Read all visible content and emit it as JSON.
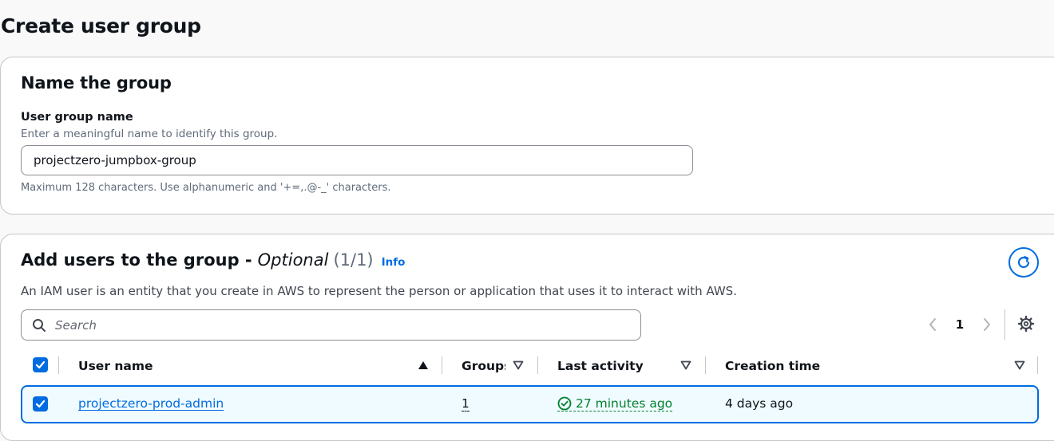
{
  "page": {
    "title": "Create user group"
  },
  "name_section": {
    "title": "Name the group",
    "field_label": "User group name",
    "field_description": "Enter a meaningful name to identify this group.",
    "field_value": "projectzero-jumpbox-group",
    "field_hint": "Maximum 128 characters. Use alphanumeric and '+=,.@-_' characters."
  },
  "users_section": {
    "title": "Add users to the group -",
    "optional": "Optional",
    "count": "(1/1)",
    "info_link": "Info",
    "description": "An IAM user is an entity that you create in AWS to represent the person or application that uses it to interact with AWS.",
    "search_placeholder": "Search",
    "pagination": {
      "current_page": "1"
    },
    "columns": [
      "User name",
      "Groups",
      "Last activity",
      "Creation time"
    ],
    "rows": [
      {
        "user_name": "projectzero-prod-admin",
        "groups": "1",
        "last_activity": "27 minutes ago",
        "creation_time": "4 days ago",
        "selected": true
      }
    ]
  },
  "colors": {
    "accent": "#006ce0",
    "success": "#00802f",
    "selected_row_bg": "#f0fbff"
  },
  "icons": [
    "refresh-icon",
    "search-icon",
    "chevron-left-icon",
    "chevron-right-icon",
    "settings-gear-icon",
    "checkmark-icon",
    "sort-ascending-icon",
    "sort-descending-icon",
    "status-success-icon"
  ]
}
